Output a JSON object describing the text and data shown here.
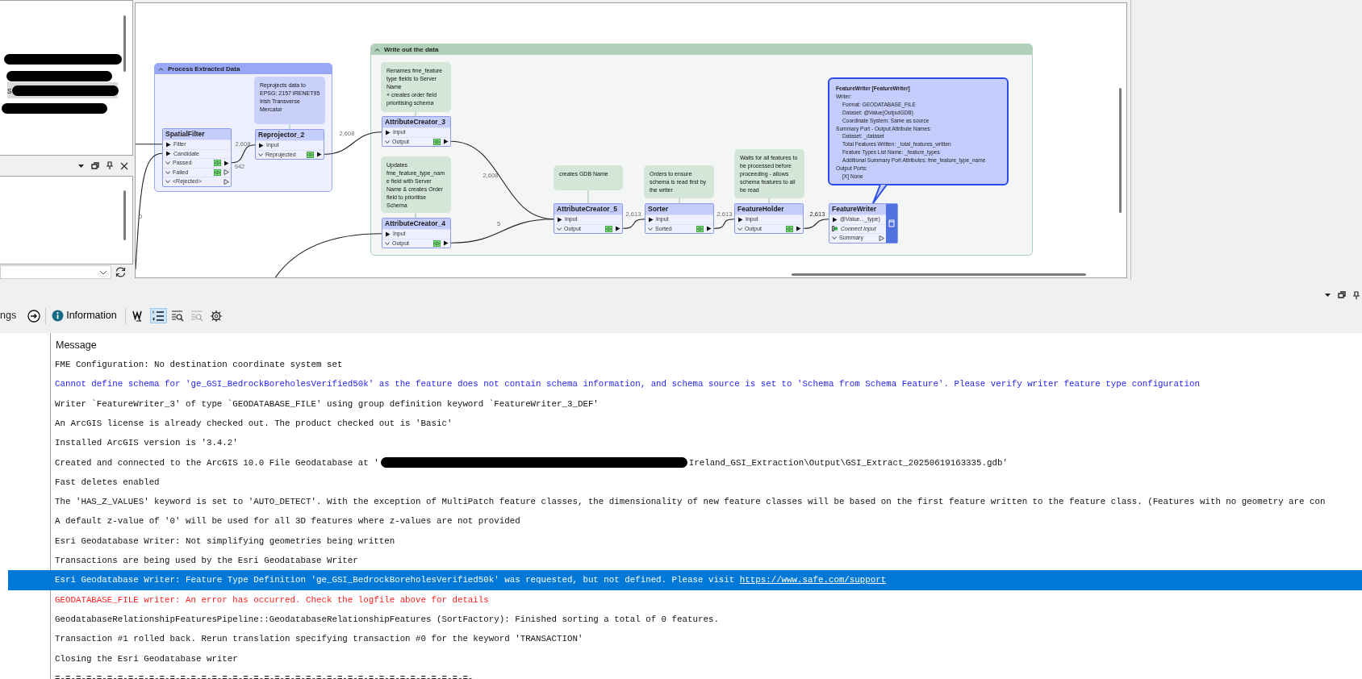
{
  "navigator": {
    "items": [
      {
        "selected": false
      },
      {
        "selected": false
      },
      {
        "selected": true,
        "text": "s"
      },
      {
        "selected": false
      }
    ]
  },
  "canvas": {
    "bookmarks": [
      {
        "title": "Process Extracted Data",
        "color": "#98a8f7"
      },
      {
        "title": "Write out the data",
        "color": "#b1d0ba"
      }
    ],
    "annotations": [
      {
        "text": "Reprojects data to EPSG: 2157 IRENET95 Irish Transverse Mercator",
        "color": "#c9d1fb"
      },
      {
        "text": "Renames fme_feature type fields to Server Name\n+ creates order field prioritising schema",
        "color": "#d3e6d8"
      },
      {
        "text": "Updates fme_feature_type_name field with Server Name & creates Order field to prioritise Schema",
        "color": "#d3e6d8"
      },
      {
        "text": "creates GDB Name",
        "color": "#d3e6d8"
      },
      {
        "text": "Orders to ensure schema is read first by the writer",
        "color": "#d3e6d8"
      },
      {
        "text": "Waits for all features to be processed before proceeding - allows schema features to all be read",
        "color": "#d3e6d8"
      }
    ],
    "transformers": [
      {
        "name": "SpatialFilter",
        "kind": "transformer",
        "ports": [
          {
            "label": "Filter",
            "kind": "input",
            "connected": true
          },
          {
            "label": "Candidate",
            "kind": "input",
            "connected": true
          },
          {
            "label": "Passed",
            "kind": "output",
            "connected": true,
            "inspect": true
          },
          {
            "label": "Failed",
            "kind": "output",
            "connected": false,
            "inspect": true
          },
          {
            "label": "<Rejected>",
            "kind": "output",
            "connected": false,
            "inspect": false
          }
        ]
      },
      {
        "name": "Reprojector_2",
        "kind": "transformer",
        "ports": [
          {
            "label": "Input",
            "kind": "input",
            "connected": true
          },
          {
            "label": "Reprojected",
            "kind": "output",
            "connected": true,
            "inspect": true
          }
        ]
      },
      {
        "name": "AttributeCreator_3",
        "kind": "transformer",
        "ports": [
          {
            "label": "Input",
            "kind": "input",
            "connected": true
          },
          {
            "label": "Output",
            "kind": "output",
            "connected": true,
            "inspect": true
          }
        ]
      },
      {
        "name": "AttributeCreator_4",
        "kind": "transformer",
        "ports": [
          {
            "label": "Input",
            "kind": "input",
            "connected": true
          },
          {
            "label": "Output",
            "kind": "output",
            "connected": true,
            "inspect": true
          }
        ]
      },
      {
        "name": "AttributeCreator_5",
        "kind": "transformer",
        "ports": [
          {
            "label": "Input",
            "kind": "input",
            "connected": true
          },
          {
            "label": "Output",
            "kind": "output",
            "connected": true,
            "inspect": true
          }
        ]
      },
      {
        "name": "Sorter",
        "kind": "transformer",
        "ports": [
          {
            "label": "Input",
            "kind": "input",
            "connected": true
          },
          {
            "label": "Sorted",
            "kind": "output",
            "connected": true,
            "inspect": true
          }
        ]
      },
      {
        "name": "FeatureHolder",
        "kind": "transformer",
        "ports": [
          {
            "label": "Input",
            "kind": "input",
            "connected": true
          },
          {
            "label": "Output",
            "kind": "output",
            "connected": true,
            "inspect": true
          }
        ]
      },
      {
        "name": "FeatureWriter",
        "kind": "writer",
        "ports": [
          {
            "label": "@Value..._type)",
            "kind": "input",
            "connected": true
          },
          {
            "label": "Connect Input",
            "kind": "connect",
            "connected": false
          },
          {
            "label": "Summary",
            "kind": "output",
            "connected": false,
            "inspect": false
          }
        ]
      }
    ],
    "connections": [
      {
        "count": "0"
      },
      {
        "count": "2,608"
      },
      {
        "count": "942"
      },
      {
        "count": "2,608"
      },
      {
        "count": "2,608"
      },
      {
        "count": "5"
      },
      {
        "count": "2,613"
      },
      {
        "count": "2,613"
      },
      {
        "count": "2,613"
      }
    ],
    "tooltip": {
      "title": "FeatureWriter [FeatureWriter]",
      "sections": [
        {
          "heading": "Writer:",
          "items": [
            "Format: GEODATABASE_FILE",
            "Dataset: @Value(OutputGDB)",
            "Coordinate System: Same as source"
          ]
        },
        {
          "heading": "Summary Port - Output Attribute Names:",
          "items": [
            "Dataset: _dataset",
            "Total Features Written: _total_features_written",
            "Feature Types List Name: _feature_types",
            "Additional Summary Port Attributes: fme_feature_type_name"
          ]
        },
        {
          "heading": "Output Ports:",
          "items": [
            "[X] None"
          ]
        }
      ]
    }
  },
  "toolbar": {
    "cut_label": "ngs",
    "info_label": "Information",
    "view_toggles": [
      {
        "selected": false,
        "disabled": false
      },
      {
        "selected": true,
        "disabled": false
      },
      {
        "selected": false,
        "disabled": false
      },
      {
        "selected": false,
        "disabled": true
      },
      {
        "selected": false,
        "disabled": false
      }
    ]
  },
  "log": {
    "column": "Message",
    "rows": [
      {
        "text": "FME Configuration: No destination coordinate system set",
        "color": "#111111",
        "selected": false
      },
      {
        "text": "Cannot define schema for 'ge_GSI_BedrockBoreholesVerified50k' as the feature does not contain schema information, and schema source is set to 'Schema from Schema Feature'. Please verify writer feature type configuration",
        "color": "#1f1ff0",
        "selected": false
      },
      {
        "text": "Writer `FeatureWriter_3' of type `GEODATABASE_FILE' using group definition keyword `FeatureWriter_3_DEF'",
        "color": "#111111",
        "selected": false
      },
      {
        "text": "An ArcGIS license is already checked out. The product checked out is 'Basic'",
        "color": "#111111",
        "selected": false
      },
      {
        "text": "Installed ArcGIS version is '3.4.2'",
        "color": "#111111",
        "selected": false
      },
      {
        "text": "Created and connected to the ArcGIS 10.0 File Geodatabase at '",
        "after_redaction": "Ireland_GSI_Extraction\\Output\\GSI_Extract_20250619163335.gdb'",
        "color": "#111111",
        "selected": false
      },
      {
        "text": "Fast deletes enabled",
        "color": "#111111",
        "selected": false
      },
      {
        "text": "The 'HAS_Z_VALUES' keyword is set to 'AUTO_DETECT'. With the exception of MultiPatch feature classes, the dimensionality of new feature classes will be based on the first feature written to the feature class. (Features with no geometry are con",
        "color": "#111111",
        "selected": false
      },
      {
        "text": "A default z-value of '0' will be used for all 3D features where z-values are not provided",
        "color": "#111111",
        "selected": false
      },
      {
        "text": "Esri Geodatabase Writer: Not simplifying geometries being written",
        "color": "#111111",
        "selected": false
      },
      {
        "text": "Transactions are being used by the Esri Geodatabase Writer",
        "color": "#111111",
        "selected": false
      },
      {
        "text": "Esri Geodatabase Writer: Feature Type Definition 'ge_GSI_BedrockBoreholesVerified50k' was requested, but not defined. Please visit ",
        "link": "https://www.safe.com/support",
        "selected": true
      },
      {
        "text": "GEODATABASE_FILE writer: An error has occurred. Check the logfile above for details",
        "color": "#ff1f1f",
        "selected": false
      },
      {
        "text": "GeodatabaseRelationshipFeaturesPipeline::GeodatabaseRelationshipFeatures (SortFactory): Finished sorting a total of 0 features.",
        "color": "#111111",
        "selected": false
      },
      {
        "text": "Transaction #1 rolled back. Rerun translation specifying transaction #0 for the keyword 'TRANSACTION'",
        "color": "#111111",
        "selected": false
      },
      {
        "text": "Closing the Esri Geodatabase writer",
        "color": "#111111",
        "selected": false
      },
      {
        "text": "=-=-=-=-=-=-=-=-=-=-=-=-=-=-=-=-=-=-=-=-=-=-=-=-=-=-=-=-=-=-=-=-=-=-=-=-=-=-=-=-",
        "color": "#111111",
        "selected": false
      }
    ]
  }
}
